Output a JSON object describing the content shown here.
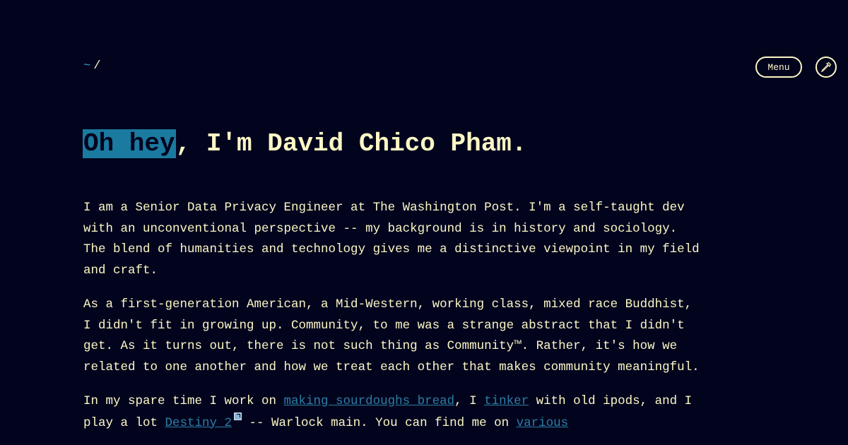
{
  "nav": {
    "home_symbol": "~",
    "separator": "/",
    "menu_label": "Menu",
    "theme_icon": "eyedropper-icon"
  },
  "hero": {
    "highlight": "Oh hey",
    "rest": ", I'm David Chico Pham."
  },
  "bio": {
    "p1": "I am a Senior Data Privacy Engineer at The Washington Post. I'm a self-taught dev with an unconventional perspective -- my background is in history and sociology. The blend of humanities and technology gives me a distinctive viewpoint in my field and craft.",
    "p2": "As a first-generation American, a Mid-Western, working class, mixed race Buddhist, I didn't fit in growing up. Community, to me was a strange abstract that I didn't get. As it turns out, there is not such thing as Community™. Rather, it's how we related to one another and how we treat each other that makes community meaningful.",
    "p3": {
      "t1": "In my spare time I work on ",
      "link1": "making sourdoughs bread",
      "t2": ", I ",
      "link2": "tinker",
      "t3": " with old ipods, and I play a lot ",
      "link3": "Destiny 2",
      "t4": " -- Warlock main. You can find me on ",
      "link4": "various"
    }
  },
  "colors": {
    "background": "#02041e",
    "text": "#fcf7c5",
    "accent": "#1a7aa0",
    "link": "#2c7fa6"
  }
}
